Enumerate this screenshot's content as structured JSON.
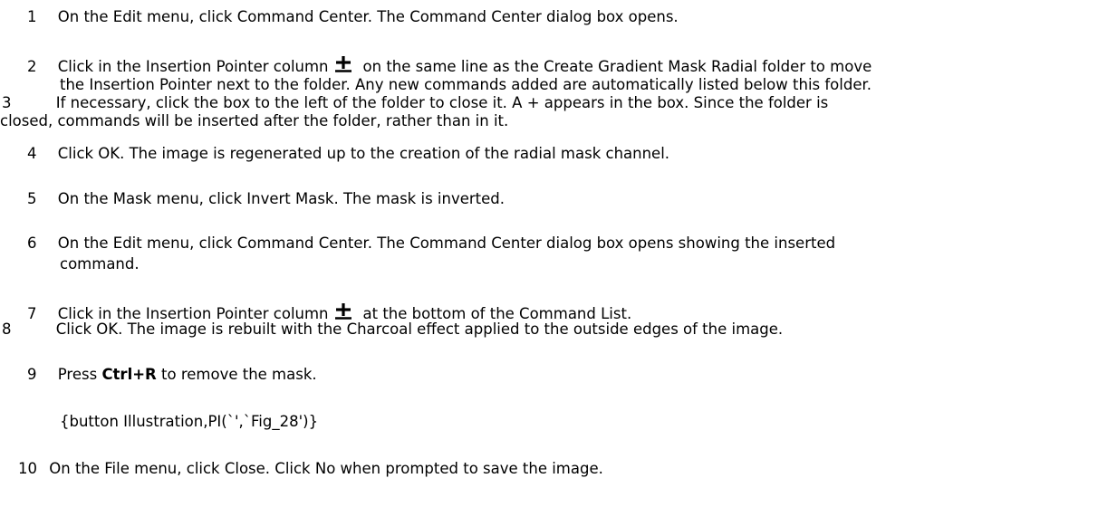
{
  "steps": [
    {
      "num": "1",
      "text": "On the Edit menu, click Command Center. The Command Center dialog box opens."
    },
    {
      "num": "2",
      "text_a": "Click in the Insertion Pointer column",
      "text_b": "on the same line as the Create Gradient Mask Radial folder to move",
      "cont": "the Insertion Pointer next to the folder. Any new commands added are automatically listed below this folder."
    },
    {
      "num": "3",
      "text": "If necessary, click the box to the left of the folder to close it. A + appears in the box. Since the folder is",
      "cont": "closed, commands will be inserted after the folder, rather than in it."
    },
    {
      "num": "4",
      "text": "Click OK. The image is regenerated up to the creation of the radial mask channel."
    },
    {
      "num": "5",
      "text": "On the Mask menu, click Invert Mask. The mask is inverted."
    },
    {
      "num": "6",
      "text": "On the Edit menu, click Command Center. The Command Center dialog box opens showing the inserted",
      "cont": "command."
    },
    {
      "num": "7",
      "text_a": "Click in the Insertion Pointer column",
      "text_b": "at the bottom of the Command List."
    },
    {
      "num": "8",
      "text": "Click OK. The image is rebuilt with the Charcoal effect applied to the outside edges of the image."
    },
    {
      "num": "9",
      "text_a": "Press",
      "bold": "Ctrl+R",
      "text_b": "to remove the mask."
    },
    {
      "num": "10",
      "text": "On the File menu, click Close. Click No when prompted to save the image."
    }
  ],
  "macro_text": "{button Illustration,PI(`',`Fig_28')}",
  "icons": {
    "insertion_pointer": "insertion-pointer-icon"
  }
}
